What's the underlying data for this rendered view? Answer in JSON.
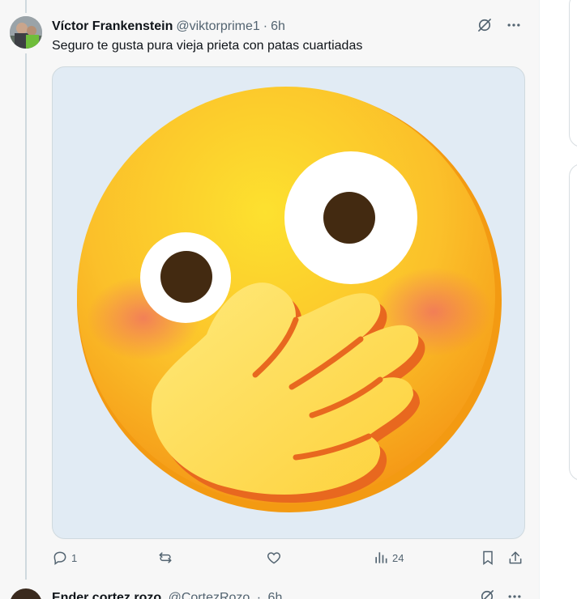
{
  "tweet": {
    "name": "Víctor Frankenstein",
    "handle": "@viktorprime1",
    "separator": "·",
    "time": "6h",
    "text": "Seguro te gusta pura vieja prieta con patas cuartiadas",
    "media_icon": "hand-over-mouth-emoji",
    "header_icons": [
      "grok-icon",
      "more-icon"
    ],
    "actions": {
      "replies": "1",
      "reposts": "",
      "likes": "",
      "views": "24"
    }
  },
  "next_tweet": {
    "name": "Ender cortez rozo",
    "handle": "@CortezRozo",
    "separator": "·",
    "time": "6h"
  },
  "colors": {
    "feed_bg": "#f7f7f7",
    "media_bg": "#e1ebf4",
    "secondary_text": "#536471",
    "primary_text": "#0f1419"
  }
}
